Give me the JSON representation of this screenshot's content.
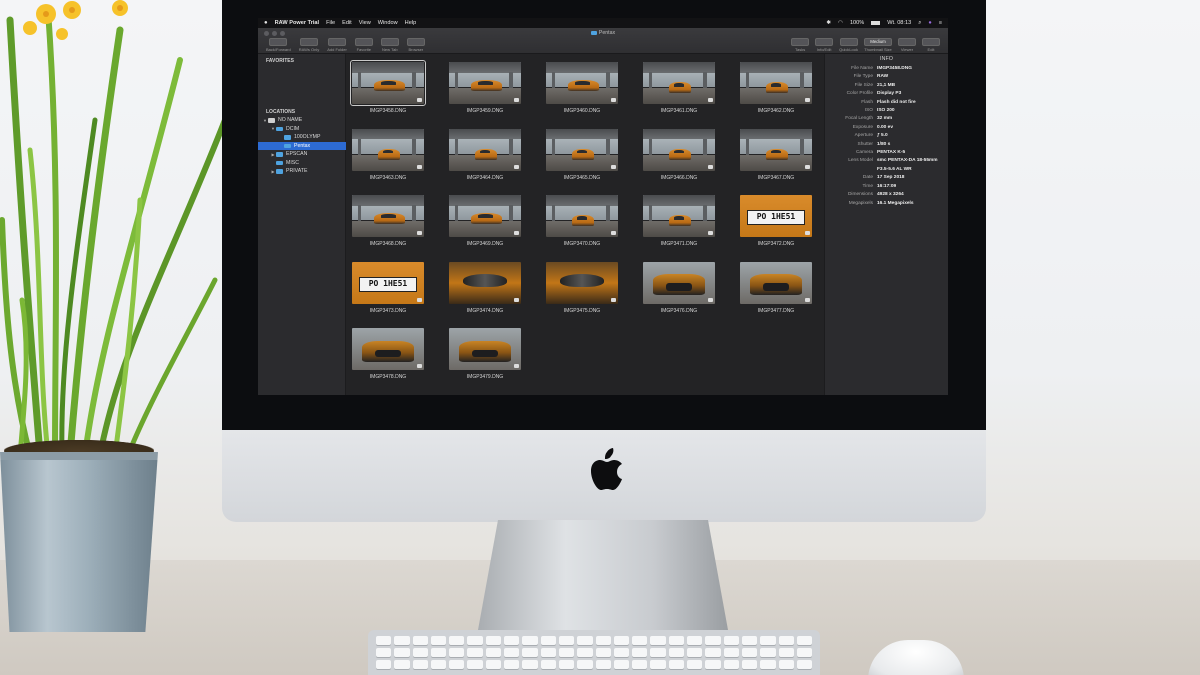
{
  "menubar": {
    "apple": "",
    "app_name": "RAW Power Trial",
    "menus": [
      "File",
      "Edit",
      "View",
      "Window",
      "Help"
    ],
    "battery": "100%",
    "clock": "Wt. 08:13"
  },
  "window": {
    "title": "Pentax",
    "toolbar_left": [
      {
        "label": "Back/Forward",
        "icon": "arrows-icon"
      },
      {
        "label": "RAWs Only",
        "icon": "raw-filter-icon"
      },
      {
        "label": "Add Folder",
        "icon": "add-folder-icon"
      },
      {
        "label": "Favorite",
        "icon": "favorite-icon"
      },
      {
        "label": "New Tab",
        "icon": "new-tab-icon"
      },
      {
        "label": "Browser",
        "icon": "browser-icon"
      }
    ],
    "toolbar_right": [
      {
        "label": "Tasks",
        "icon": "tasks-icon"
      },
      {
        "label": "Info/Edit",
        "icon": "info-edit-icon"
      },
      {
        "label": "QuickLook",
        "icon": "eye-icon"
      },
      {
        "label": "Thumbnail Size",
        "value": "Medium"
      },
      {
        "label": "Viewer",
        "icon": "viewer-icon"
      },
      {
        "label": "Edit",
        "icon": "edit-icon"
      }
    ]
  },
  "sidebar": {
    "favorites_header": "FAVORITES",
    "locations_header": "LOCATIONS",
    "items": [
      {
        "label": "NO NAME",
        "level": 0,
        "expanded": true,
        "kind": "drive"
      },
      {
        "label": "DCIM",
        "level": 1,
        "expanded": true,
        "kind": "folder"
      },
      {
        "label": "100OLYMP",
        "level": 2,
        "kind": "folder"
      },
      {
        "label": "Pentax",
        "level": 2,
        "kind": "folder",
        "selected": true
      },
      {
        "label": "EPSCAN",
        "level": 1,
        "expanded": false,
        "kind": "folder"
      },
      {
        "label": "MISC",
        "level": 1,
        "kind": "folder"
      },
      {
        "label": "PRIVATE",
        "level": 1,
        "expanded": false,
        "kind": "folder"
      }
    ]
  },
  "thumbnails": [
    {
      "name": "IMGP3458.DNG",
      "kind": "side",
      "selected": true
    },
    {
      "name": "IMGP3459.DNG",
      "kind": "side"
    },
    {
      "name": "IMGP3460.DNG",
      "kind": "side"
    },
    {
      "name": "IMGP3461.DNG",
      "kind": "far"
    },
    {
      "name": "IMGP3462.DNG",
      "kind": "far"
    },
    {
      "name": "IMGP3463.DNG",
      "kind": "far"
    },
    {
      "name": "IMGP3464.DNG",
      "kind": "far"
    },
    {
      "name": "IMGP3465.DNG",
      "kind": "far"
    },
    {
      "name": "IMGP3466.DNG",
      "kind": "far"
    },
    {
      "name": "IMGP3467.DNG",
      "kind": "far"
    },
    {
      "name": "IMGP3468.DNG",
      "kind": "side"
    },
    {
      "name": "IMGP3469.DNG",
      "kind": "side"
    },
    {
      "name": "IMGP3470.DNG",
      "kind": "far"
    },
    {
      "name": "IMGP3471.DNG",
      "kind": "far"
    },
    {
      "name": "IMGP3472.DNG",
      "kind": "plate",
      "plate": "PO 1HE51"
    },
    {
      "name": "IMGP3473.DNG",
      "kind": "plate",
      "plate": "PO 1HE51"
    },
    {
      "name": "IMGP3474.DNG",
      "kind": "mirror"
    },
    {
      "name": "IMGP3475.DNG",
      "kind": "mirror"
    },
    {
      "name": "IMGP3476.DNG",
      "kind": "front"
    },
    {
      "name": "IMGP3477.DNG",
      "kind": "front"
    },
    {
      "name": "IMGP3478.DNG",
      "kind": "front"
    },
    {
      "name": "IMGP3479.DNG",
      "kind": "front"
    }
  ],
  "info": {
    "title": "INFO",
    "rows": [
      {
        "k": "File Name",
        "v": "IMGP3458.DNG"
      },
      {
        "k": "File Type",
        "v": "RAW"
      },
      {
        "k": "File Size",
        "v": "21,1 MB"
      },
      {
        "k": "Color Profile",
        "v": "Display P3"
      },
      {
        "k": "Flash",
        "v": "Flash did not fire"
      },
      {
        "k": "ISO",
        "v": "ISO 200"
      },
      {
        "k": "Focal Length",
        "v": "32 mm"
      },
      {
        "k": "Exposure",
        "v": "0.00 ev"
      },
      {
        "k": "Aperture",
        "v": "ƒ 5.0"
      },
      {
        "k": "Shutter",
        "v": "1/80 s"
      },
      {
        "k": "Camera",
        "v": "PENTAX K-5"
      },
      {
        "k": "Lens Model",
        "v": "smc PENTAX-DA 18-55mm"
      },
      {
        "k": "",
        "v": "F3.5-5.6 AL WR"
      },
      {
        "k": "Date",
        "v": "17 Sep 2018"
      },
      {
        "k": "Time",
        "v": "16:17:09"
      },
      {
        "k": "Dimensions",
        "v": "4928 x 3264"
      },
      {
        "k": "Megapixels",
        "v": "16.1 Megapixels"
      }
    ]
  },
  "colors": {
    "selection": "#2d6bd3",
    "folder": "#4fa3e0",
    "car_orange": "#d98b2b"
  }
}
